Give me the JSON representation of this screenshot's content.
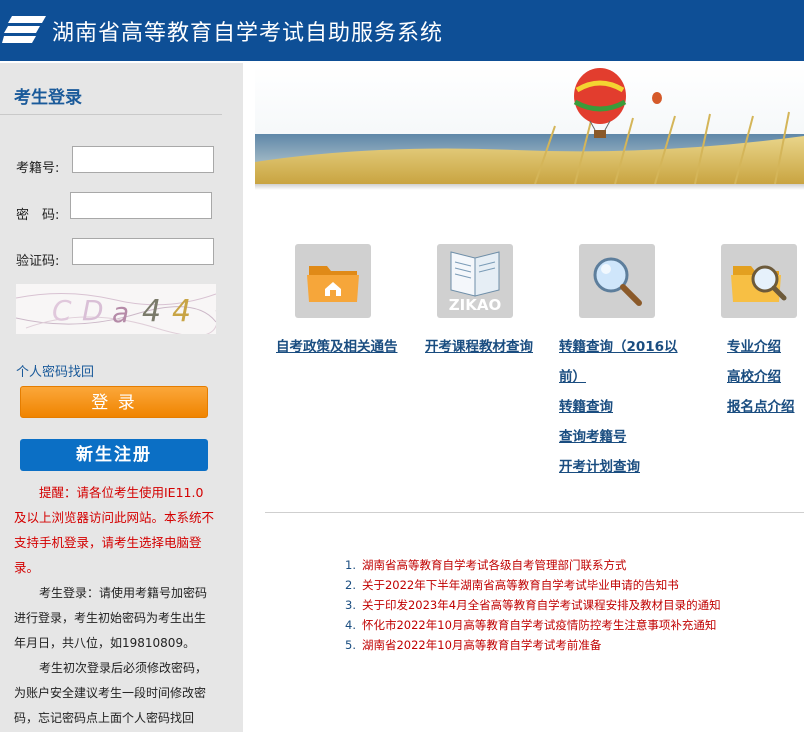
{
  "header": {
    "title": "湖南省高等教育自学考试自助服务系统"
  },
  "login": {
    "title": "考生登录",
    "exam_no_label": "考籍号:",
    "password_label": "密　码:",
    "captcha_label": "验证码:",
    "captcha_text": [
      "C",
      "D",
      "a",
      "4",
      "4"
    ],
    "forgot_link": "个人密码找回",
    "login_button": "登 录",
    "register_button": "新生注册",
    "notice": "提醒：请各位考生使用IE11.0及以上浏览器访问此网站。本系统不支持手机登录，请考生选择电脑登录。",
    "info1": "考生登录：请使用考籍号加密码进行登录，考生初始密码为考生出生年月日，共八位，如19810809。",
    "info2": "考生初次登录后必须修改密码，为账户安全建议考生一段时间修改密码，忘记密码点上面个人密码找回"
  },
  "banner": {
    "logo_word": "ZIKAO"
  },
  "quick_links": [
    {
      "label": "自考政策及相关通告",
      "icon": "folder-home-icon"
    },
    {
      "label": "开考课程教材查询",
      "icon": "book-icon"
    },
    {
      "label": "转籍查询（2016以",
      "label2": "前）",
      "icon": "magnifier-icon"
    },
    {
      "label": "专业介绍",
      "icon": "folder-search-icon"
    }
  ],
  "sub_links": {
    "col3": [
      "转籍查询",
      "查询考籍号",
      "开考计划查询"
    ],
    "col4": [
      "高校介绍",
      "报名点介绍"
    ]
  },
  "news": [
    {
      "num": "1.",
      "title": "湖南省高等教育自学考试各级自考管理部门联系方式"
    },
    {
      "num": "2.",
      "title": "关于2022年下半年湖南省高等教育自学考试毕业申请的告知书"
    },
    {
      "num": "3.",
      "title": "关于印发2023年4月全省高等教育自学考试课程安排及教材目录的通知"
    },
    {
      "num": "4.",
      "title": "怀化市2022年10月高等教育自学考试疫情防控考生注意事项补充通知"
    },
    {
      "num": "5.",
      "title": "湖南省2022年10月高等教育自学考试考前准备"
    }
  ]
}
